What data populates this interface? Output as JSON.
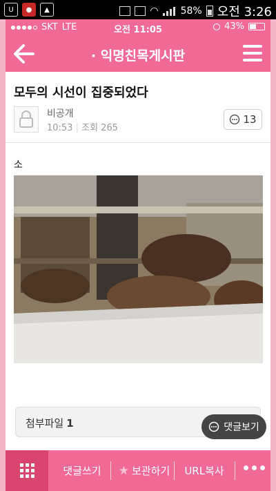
{
  "android_status": {
    "battery": "58%",
    "time": "오전 3:26"
  },
  "ios_status": {
    "carrier": "SKT",
    "network": "LTE",
    "time": "오전 11:05",
    "battery": "43%"
  },
  "header": {
    "title": "· 익명친목게시판"
  },
  "post": {
    "title": "모두의 시선이 집중되었다",
    "author": "비공개",
    "time": "10:53",
    "views": "조회 265",
    "comment_count": "13",
    "body": "소"
  },
  "attachment": {
    "label": "첨부파일",
    "count": "1"
  },
  "view_comments": {
    "label": "댓글보기"
  },
  "toolbar": {
    "write_comment": "댓글쓰기",
    "save": "보관하기",
    "copy_url": "URL복사"
  },
  "colors": {
    "brand_pink": "#f06a95",
    "dark_pink": "#d9456f"
  }
}
